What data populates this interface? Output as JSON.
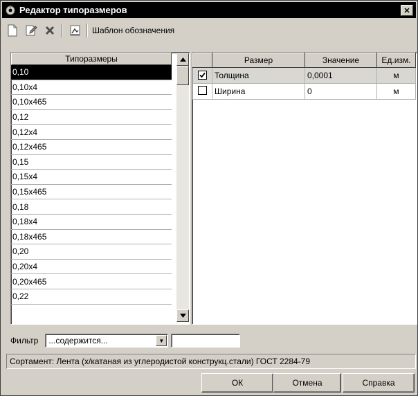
{
  "window": {
    "title": "Редактор типоразмеров",
    "close": "✕"
  },
  "toolbar": {
    "icons": [
      "new-doc-icon",
      "edit-doc-icon",
      "delete-icon",
      "template-icon"
    ],
    "template_label": "Шаблон обозначения"
  },
  "left": {
    "header": "Типоразмеры",
    "items": [
      "0,10",
      "0,10x4",
      "0,10x465",
      "0,12",
      "0,12x4",
      "0,12x465",
      "0,15",
      "0,15x4",
      "0,15x465",
      "0,18",
      "0,18x4",
      "0,18x465",
      "0,20",
      "0,20x4",
      "0,20x465",
      "0,22"
    ],
    "selected_index": 0
  },
  "right": {
    "headers": [
      "",
      "Размер",
      "Значение",
      "Ед.изм."
    ],
    "rows": [
      {
        "checked": true,
        "name": "Толщина",
        "value": "0,0001",
        "unit": "м"
      },
      {
        "checked": false,
        "name": "Ширина",
        "value": "0",
        "unit": "м"
      }
    ]
  },
  "filter": {
    "label": "Фильтр",
    "mode": "...содержится...",
    "value": ""
  },
  "status": "Сортамент: Лента (х/катаная из углеродистой конструкц.стали) ГОСТ 2284-79",
  "buttons": {
    "ok": "ОК",
    "cancel": "Отмена",
    "help": "Справка"
  }
}
